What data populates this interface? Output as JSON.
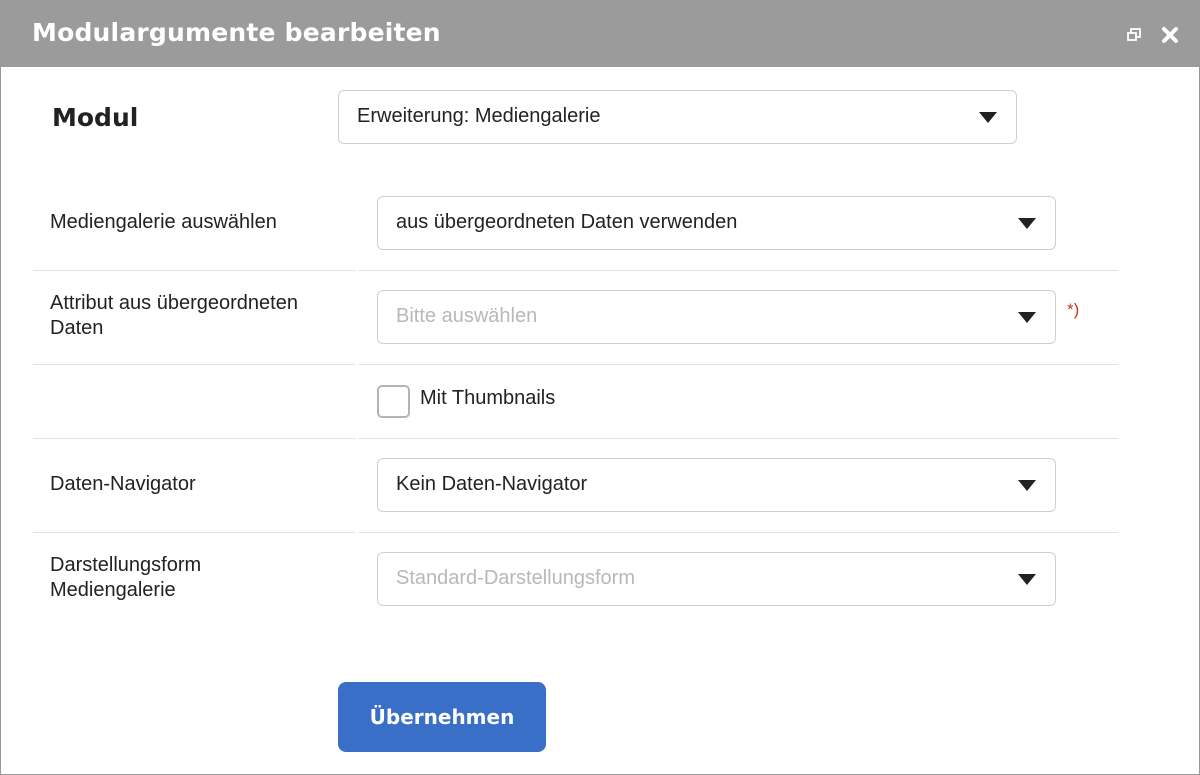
{
  "dialog": {
    "title": "Modulargumente bearbeiten",
    "restore_icon": "restore-window-icon",
    "close_icon": "close-icon"
  },
  "module": {
    "label": "Modul",
    "value": "Erweiterung: Mediengalerie"
  },
  "fields": [
    {
      "label": "Mediengalerie auswählen",
      "value": "aus übergeordneten Daten verwenden"
    },
    {
      "label": "Attribut aus übergeordneten Daten",
      "placeholder": "Bitte auswählen",
      "required_marker": "*)"
    },
    {
      "checkbox_label": "Mit Thumbnails",
      "checked": false
    },
    {
      "label": "Daten-Navigator",
      "value": "Kein Daten-Navigator"
    },
    {
      "label": "Darstellungsform Mediengalerie",
      "placeholder": "Standard-Darstellungsform"
    }
  ],
  "actions": {
    "apply_label": "Übernehmen"
  },
  "colors": {
    "titlebar": "#9b9b9b",
    "primary": "#3a6fc7",
    "required": "#c0392b"
  }
}
